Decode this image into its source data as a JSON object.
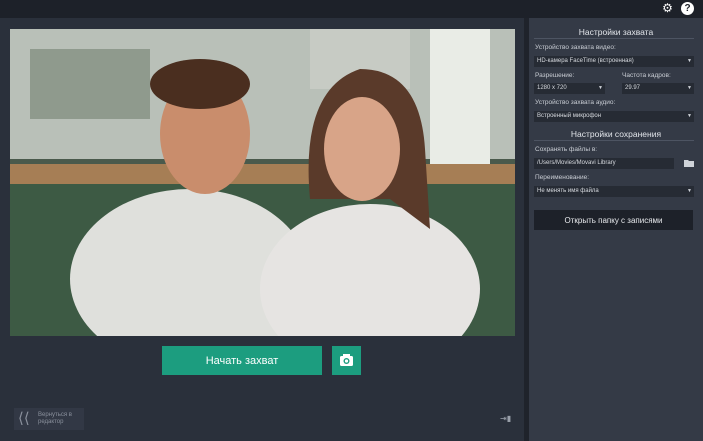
{
  "topbar": {
    "settings_icon": "gear-icon",
    "help_icon": "help-icon",
    "help_glyph": "?"
  },
  "main": {
    "capture_button": "Начать захват",
    "snapshot_icon": "camera-icon",
    "back_label": "Вернуться в редактор",
    "collapse_icon": "collapse-panel-icon"
  },
  "panel": {
    "capture_title": "Настройки захвата",
    "video_device_label": "Устройство захвата видео:",
    "video_device_value": "HD-камера FaceTime (встроенная)",
    "resolution_label": "Разрешение:",
    "resolution_value": "1280 x 720",
    "framerate_label": "Частота кадров:",
    "framerate_value": "29.97",
    "audio_device_label": "Устройство захвата аудио:",
    "audio_device_value": "Встроенный микрофон",
    "save_title": "Настройки сохранения",
    "save_to_label": "Сохранять файлы в:",
    "save_to_value": "/Users/Movies/Movavi Library",
    "rename_label": "Переименование:",
    "rename_value": "Не менять имя файла",
    "open_folder_button": "Открыть папку с записями"
  },
  "colors": {
    "accent": "#1c9d7f",
    "background": "#2a303b",
    "panel": "#343a46"
  }
}
